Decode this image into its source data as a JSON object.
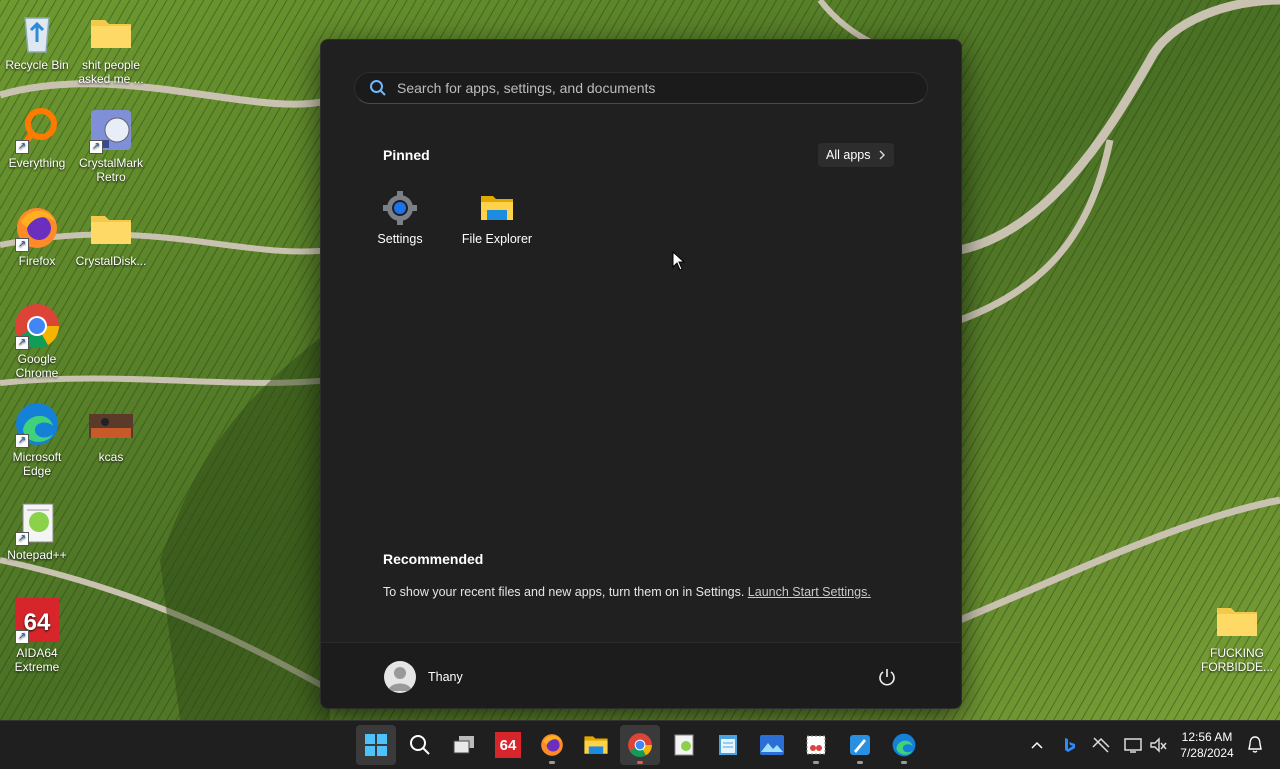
{
  "desktop": {
    "icons": [
      {
        "label": "Recycle Bin",
        "icon": "recycle-bin-icon"
      },
      {
        "label": "shit people asked me ...",
        "icon": "folder-icon"
      },
      {
        "label": "Everything",
        "icon": "everything-search-icon"
      },
      {
        "label": "CrystalMark Retro",
        "icon": "crystalmark-icon"
      },
      {
        "label": "Firefox",
        "icon": "firefox-icon"
      },
      {
        "label": "CrystalDisk...",
        "icon": "folder-icon"
      },
      {
        "label": "Google Chrome",
        "icon": "chrome-icon"
      },
      {
        "label": "Microsoft Edge",
        "icon": "edge-icon"
      },
      {
        "label": "kcas",
        "icon": "image-thumbnail-icon"
      },
      {
        "label": "Notepad++",
        "icon": "notepadpp-icon"
      },
      {
        "label": "AIDA64 Extreme",
        "icon": "aida64-icon"
      },
      {
        "label": "FUCKING FORBIDDE...",
        "icon": "folder-icon"
      }
    ]
  },
  "start_menu": {
    "search_placeholder": "Search for apps, settings, and documents",
    "pinned_title": "Pinned",
    "all_apps_label": "All apps",
    "pinned": [
      {
        "label": "Settings",
        "icon": "settings-gear-icon"
      },
      {
        "label": "File Explorer",
        "icon": "file-explorer-icon"
      }
    ],
    "recommended_title": "Recommended",
    "recommended_text": "To show your recent files and new apps, turn them on in Settings.",
    "recommended_link": "Launch Start Settings.",
    "user_name": "Thany",
    "power_icon": "power-icon"
  },
  "taskbar": {
    "apps": [
      {
        "icon": "start-windows-icon",
        "active": true
      },
      {
        "icon": "search-icon"
      },
      {
        "icon": "task-view-icon"
      },
      {
        "icon": "aida64-icon",
        "text": "64"
      },
      {
        "icon": "firefox-icon"
      },
      {
        "icon": "file-explorer-icon"
      },
      {
        "icon": "chrome-icon",
        "active": true
      },
      {
        "icon": "notepadpp-icon"
      },
      {
        "icon": "notepad-icon"
      },
      {
        "icon": "photos-icon"
      },
      {
        "icon": "snipping-tool-icon"
      },
      {
        "icon": "paint-icon"
      },
      {
        "icon": "edge-icon"
      }
    ],
    "tray": [
      "chevron-up-icon",
      "bing-icon",
      "network-off-icon",
      "display-icon",
      "speaker-muted-icon"
    ],
    "clock_time": "12:56 AM",
    "clock_date": "7/28/2024",
    "notification_icon": "notification-bell-icon"
  }
}
